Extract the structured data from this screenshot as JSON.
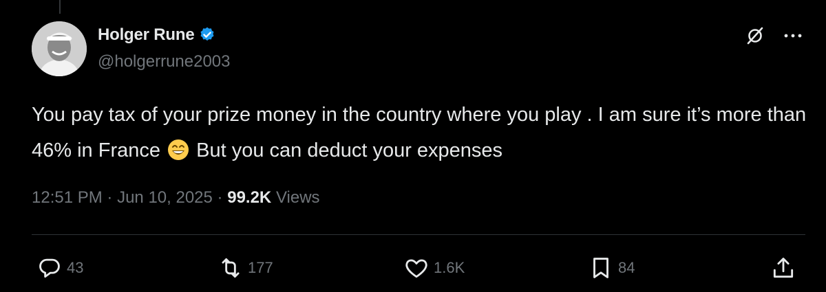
{
  "author": {
    "display_name": "Holger Rune",
    "handle": "@holgerrune2003",
    "verified": true,
    "verified_color": "#1d9bf0"
  },
  "tweet": {
    "text_part1": "You pay tax of your prize money in the country where you play . I am sure it’s more than 46% in France ",
    "emoji": "grinning-face-with-smiling-eyes",
    "text_part2": " But you can deduct your expenses",
    "time": "12:51 PM",
    "date": "Jun 10, 2025",
    "views_count": "99.2K",
    "views_label": "Views"
  },
  "actions": {
    "replies": "43",
    "reposts": "177",
    "likes": "1.6K",
    "bookmarks": "84"
  },
  "colors": {
    "background": "#000000",
    "text_primary": "#e7e9ea",
    "text_secondary": "#71767b",
    "divider": "#2f3336"
  }
}
